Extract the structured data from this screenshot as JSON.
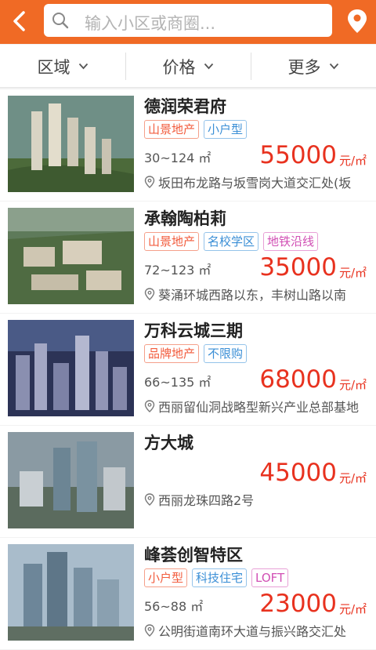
{
  "search": {
    "placeholder": "输入小区或商圈..."
  },
  "filters": [
    {
      "label": "区域"
    },
    {
      "label": "价格"
    },
    {
      "label": "更多"
    }
  ],
  "colors": {
    "brand": "#f06a25",
    "price": "#e8321f"
  },
  "icons": {
    "back": "chevron-left-icon",
    "search": "search-icon",
    "location": "location-pin-icon",
    "address": "map-pin-icon"
  },
  "listings": [
    {
      "name": "德润荣君府",
      "tags": [
        "山景地产",
        "小户型"
      ],
      "area": "30~124 ㎡",
      "price": "55000",
      "unit": "元/㎡",
      "address": "坂田布龙路与坂雪岗大道交汇处(坂"
    },
    {
      "name": "承翰陶柏莉",
      "tags": [
        "山景地产",
        "名校学区",
        "地铁沿线"
      ],
      "area": "72~123 ㎡",
      "price": "35000",
      "unit": "元/㎡",
      "address": "葵涌环城西路以东，丰树山路以南"
    },
    {
      "name": "万科云城三期",
      "tags": [
        "品牌地产",
        "不限购"
      ],
      "area": "66~135 ㎡",
      "price": "68000",
      "unit": "元/㎡",
      "address": "西丽留仙洞战略型新兴产业总部基地"
    },
    {
      "name": "方大城",
      "tags": [],
      "area": "",
      "price": "45000",
      "unit": "元/㎡",
      "address": "西丽龙珠四路2号"
    },
    {
      "name": "峰荟创智特区",
      "tags": [
        "小户型",
        "科技住宅",
        "LOFT"
      ],
      "area": "56~88 ㎡",
      "price": "23000",
      "unit": "元/㎡",
      "address": "公明街道南环大道与振兴路交汇处"
    }
  ]
}
